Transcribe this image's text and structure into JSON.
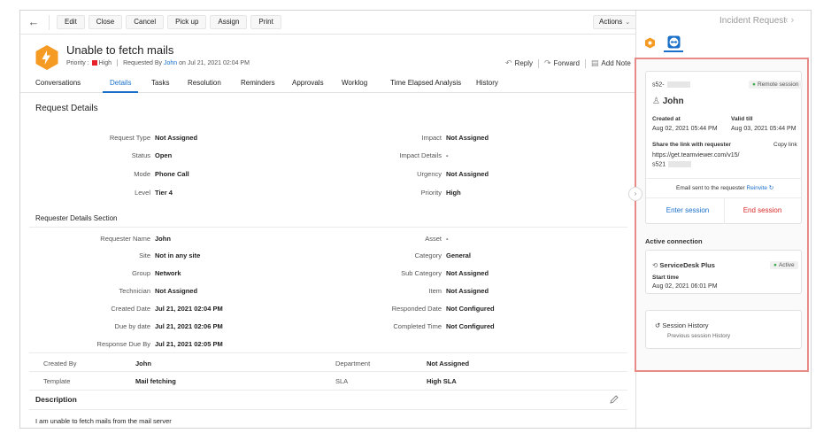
{
  "toolbar": {
    "back_label": "←",
    "buttons": [
      "Edit",
      "Close",
      "Cancel",
      "Pick up",
      "Assign",
      "Print"
    ],
    "actions_label": "Actions"
  },
  "header": {
    "title": "Unable to fetch mails",
    "priority_label": "Priority :",
    "priority_value": "High",
    "requested_by_prefix": "Requested By",
    "requester": "John",
    "requested_on": "on Jul 21, 2021 02:04 PM",
    "reply_label": "Reply",
    "forward_label": "Forward",
    "add_note_label": "Add Note"
  },
  "tabs": [
    "Conversations",
    "Details",
    "Tasks",
    "Resolution",
    "Reminders",
    "Approvals",
    "Worklog",
    "Time Elapsed Analysis",
    "History"
  ],
  "request_details": {
    "heading": "Request Details",
    "left": [
      {
        "label": "Request Type",
        "value": "Not Assigned"
      },
      {
        "label": "Status",
        "value": "Open"
      },
      {
        "label": "Mode",
        "value": "Phone Call"
      },
      {
        "label": "Level",
        "value": "Tier 4"
      }
    ],
    "right": [
      {
        "label": "Impact",
        "value": "Not Assigned"
      },
      {
        "label": "Impact Details",
        "value": "-"
      },
      {
        "label": "Urgency",
        "value": "Not Assigned"
      },
      {
        "label": "Priority",
        "value": "High"
      }
    ]
  },
  "requester_section": {
    "heading": "Requester Details Section",
    "left": [
      {
        "label": "Requester Name",
        "value": "John"
      },
      {
        "label": "Site",
        "value": "Not in any site"
      },
      {
        "label": "Group",
        "value": "Network"
      },
      {
        "label": "Technician",
        "value": "Not Assigned"
      },
      {
        "label": "Created Date",
        "value": "Jul 21, 2021 02:04 PM"
      },
      {
        "label": "Due by date",
        "value": "Jul 21, 2021 02:06 PM"
      },
      {
        "label": "Response Due By",
        "value": "Jul 21, 2021 02:05 PM"
      }
    ],
    "right": [
      {
        "label": "Asset",
        "value": "-"
      },
      {
        "label": "Category",
        "value": "General"
      },
      {
        "label": "Sub Category",
        "value": "Not Assigned"
      },
      {
        "label": "Item",
        "value": "Not Assigned"
      },
      {
        "label": "Responded Date",
        "value": "Not Configured"
      },
      {
        "label": "Completed Time",
        "value": "Not Configured"
      }
    ]
  },
  "summary_rows": [
    {
      "label1": "Created By",
      "value1": "John",
      "label2": "Department",
      "value2": "Not Assigned"
    },
    {
      "label1": "Template",
      "value1": "Mail fetching",
      "label2": "SLA",
      "value2": "High SLA"
    }
  ],
  "description": {
    "heading": "Description",
    "text": "I am unable to fetch mails from the mail server"
  },
  "right_panel": {
    "title": "Incident Request",
    "session": {
      "id_prefix": "s52-",
      "remote_badge": "Remote session",
      "user": "John",
      "created_label": "Created at",
      "created_value": "Aug 02, 2021 05:44 PM",
      "valid_label": "Valid till",
      "valid_value": "Aug 03, 2021 05:44 PM",
      "share_label": "Share the link with requester",
      "copy_label": "Copy link",
      "link_line1": "https://get.teamviewer.com/v15/",
      "link_line2": "s521",
      "email_sent": "Email sent to the requester",
      "reinvite": "Reinvite",
      "enter_label": "Enter session",
      "end_label": "End session"
    },
    "active_heading": "Active connection",
    "connection": {
      "name": "ServiceDesk Plus",
      "status": "Active",
      "start_label": "Start time",
      "start_value": "Aug 02, 2021 06:01 PM"
    },
    "history": {
      "label": "Session History",
      "sub": "Previous session History"
    }
  },
  "colors": {
    "accent": "#1a6fc9",
    "danger": "#d92a2a",
    "priority_high": "#e8202a",
    "active_green": "#3dab4e",
    "highlight_border": "#e88a86",
    "brand_orange": "#f59a23"
  },
  "icons": [
    "back-arrow-icon",
    "chevron-down-icon",
    "incident-icon",
    "reply-icon",
    "forward-icon",
    "note-icon",
    "edit-icon",
    "user-icon",
    "refresh-icon",
    "connection-icon",
    "history-icon",
    "teamviewer-icon",
    "chevron-left-icon",
    "chevron-right-icon",
    "collapse-icon"
  ]
}
